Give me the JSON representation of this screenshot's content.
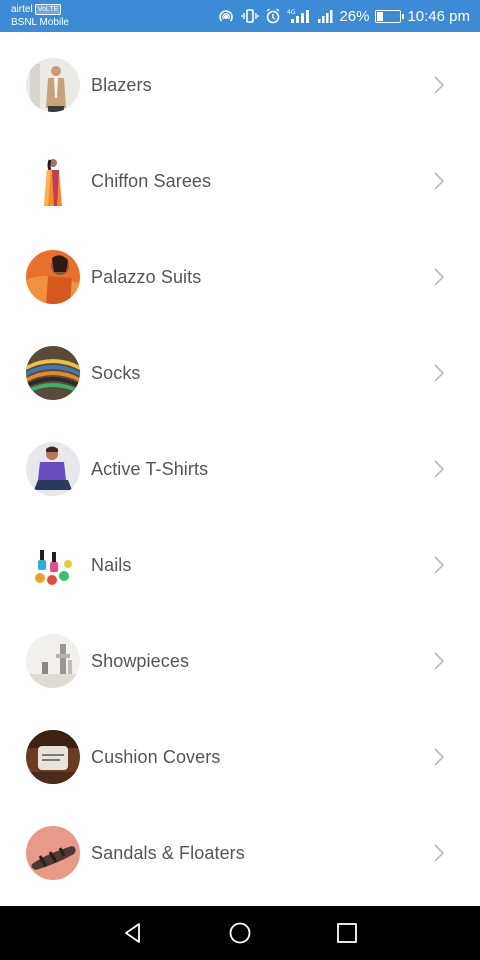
{
  "status_bar": {
    "carrier_primary": "airtel",
    "carrier_badge": "VoLTE",
    "carrier_secondary": "BSNL Mobile",
    "network_type": "4G",
    "battery_percent_text": "26%",
    "battery_level": 0.26,
    "time": "10:46 pm",
    "background_color": "#3d8bd6"
  },
  "categories": [
    {
      "label": "Blazers",
      "icon": "blazer-thumbnail"
    },
    {
      "label": "Chiffon Sarees",
      "icon": "saree-thumbnail"
    },
    {
      "label": "Palazzo Suits",
      "icon": "palazzo-thumbnail"
    },
    {
      "label": "Socks",
      "icon": "socks-thumbnail"
    },
    {
      "label": "Active T-Shirts",
      "icon": "tshirt-thumbnail"
    },
    {
      "label": "Nails",
      "icon": "nail-polish-thumbnail"
    },
    {
      "label": "Showpieces",
      "icon": "showpiece-thumbnail"
    },
    {
      "label": "Cushion Covers",
      "icon": "cushion-thumbnail"
    },
    {
      "label": "Sandals & Floaters",
      "icon": "sandal-thumbnail"
    }
  ],
  "nav_bar": {
    "back_icon": "triangle-back-icon",
    "home_icon": "circle-home-icon",
    "recents_icon": "square-recents-icon"
  }
}
